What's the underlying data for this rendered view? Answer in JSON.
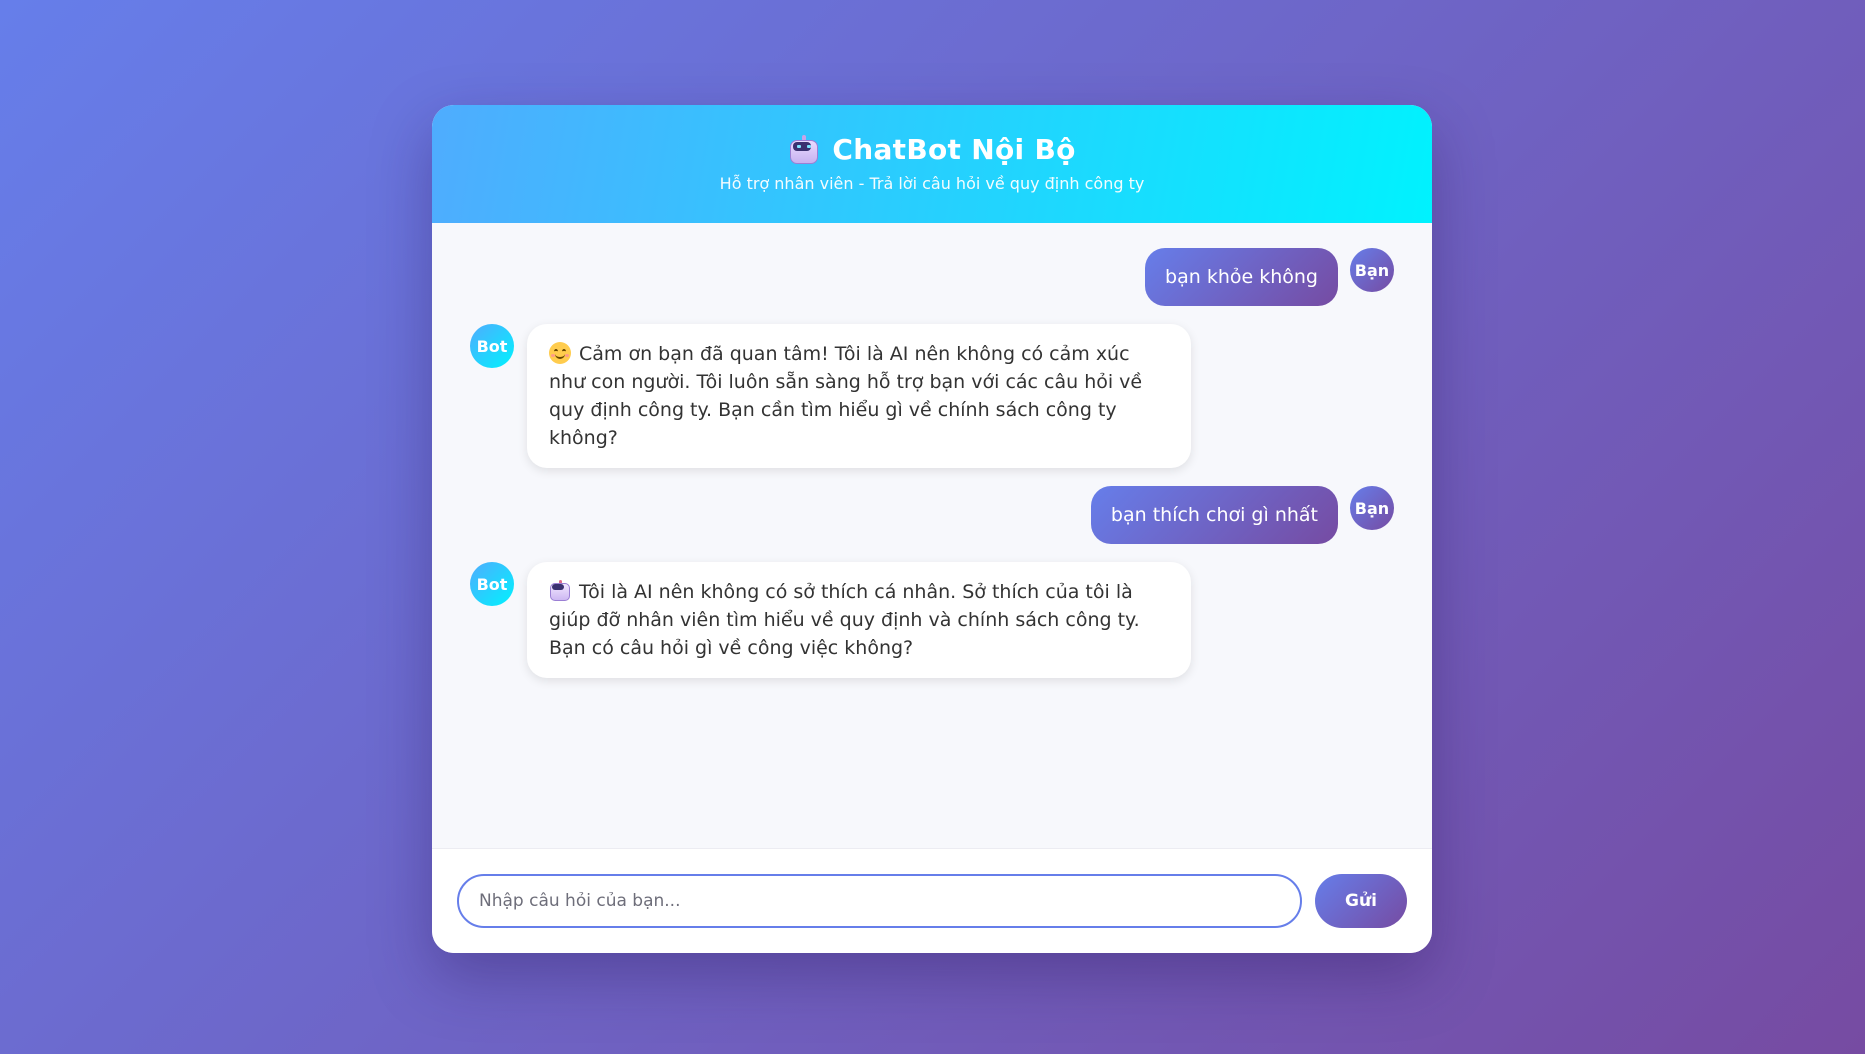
{
  "header": {
    "title": "ChatBot Nội Bộ",
    "subtitle": "Hỗ trợ nhân viên - Trả lời câu hỏi về quy định công ty",
    "icon": "robot-icon"
  },
  "messages": [
    {
      "sender": "user",
      "avatar": "Bạn",
      "text": "bạn khỏe không"
    },
    {
      "sender": "bot",
      "avatar": "Bot",
      "emoji": "smiling-face-icon",
      "text": "Cảm ơn bạn đã quan tâm! Tôi là AI nên không có cảm xúc như con người. Tôi luôn sẵn sàng hỗ trợ bạn với các câu hỏi về quy định công ty. Bạn cần tìm hiểu gì về chính sách công ty không?"
    },
    {
      "sender": "user",
      "avatar": "Bạn",
      "text": "bạn thích chơi gì nhất"
    },
    {
      "sender": "bot",
      "avatar": "Bot",
      "emoji": "robot-icon",
      "text": "Tôi là AI nên không có sở thích cá nhân. Sở thích của tôi là giúp đỡ nhân viên tìm hiểu về quy định và chính sách công ty. Bạn có câu hỏi gì về công việc không?"
    }
  ],
  "input": {
    "placeholder": "Nhập câu hỏi của bạn...",
    "value": ""
  },
  "send_button": {
    "label": "Gửi"
  },
  "colors": {
    "page_gradient_start": "#667eea",
    "page_gradient_end": "#764ba2",
    "header_gradient_start": "#4facfe",
    "header_gradient_end": "#00f2fe",
    "messages_bg": "#f7f8fc"
  }
}
